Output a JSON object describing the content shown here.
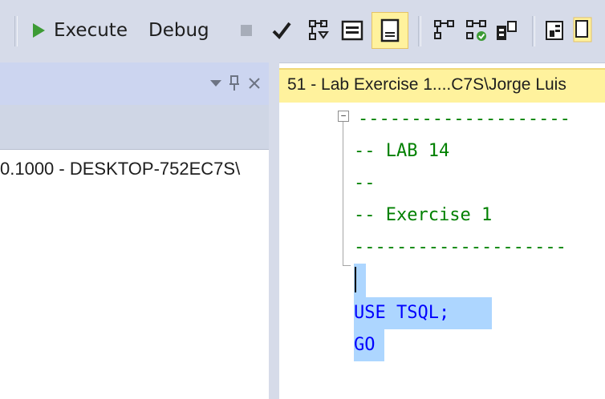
{
  "toolbar": {
    "execute_label": "Execute",
    "debug_label": "Debug",
    "icons": [
      "play-icon",
      "stop-icon",
      "parse-check-icon",
      "estimated-plan-icon",
      "results-to-text-icon",
      "results-to-grid-icon",
      "query-options-icon",
      "include-plan-icon",
      "client-stats-icon",
      "results-to-file-icon"
    ],
    "accent_colors": {
      "play": "#3d9b35",
      "check": "#1e1e1e",
      "active_bg": "#fff29d"
    }
  },
  "object_explorer": {
    "window_controls": [
      "dropdown-icon",
      "pin-icon",
      "close-icon"
    ],
    "pin_glyph": "ᵖ",
    "close_glyph": "✕",
    "node_text": "0.1000 - DESKTOP-752EC7S\\"
  },
  "document_tab": {
    "label": "51 - Lab Exercise 1....C7S\\Jorge Luis"
  },
  "editor": {
    "lines": [
      {
        "text": "--------------------",
        "kind": "comment"
      },
      {
        "text": "-- LAB 14",
        "kind": "comment"
      },
      {
        "text": "--",
        "kind": "comment"
      },
      {
        "text": "-- Exercise 1",
        "kind": "comment"
      },
      {
        "text": "--------------------",
        "kind": "comment"
      },
      {
        "text": "",
        "kind": "plain"
      },
      {
        "text": "USE TSQL;",
        "kind": "keyword"
      },
      {
        "text": "GO",
        "kind": "keyword"
      }
    ],
    "collapse_glyph": "−"
  }
}
